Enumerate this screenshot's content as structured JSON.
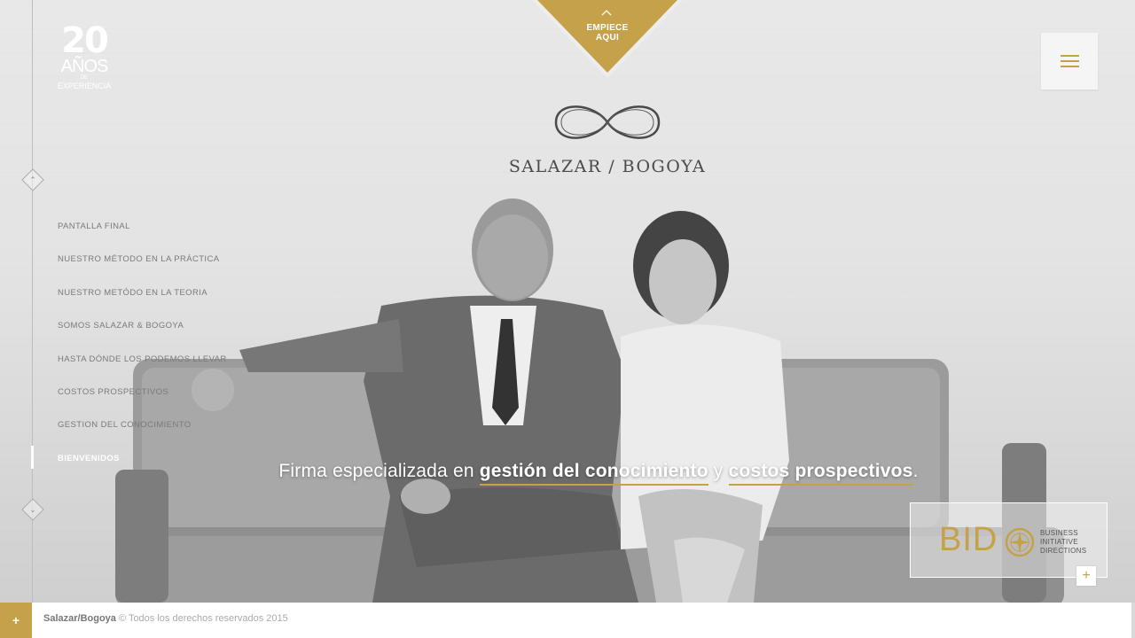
{
  "badge": {
    "number": "20",
    "years": "AÑOS",
    "de": "DE",
    "experience": "EXPERIENCIA"
  },
  "start": {
    "label_line1": "EMPIECE",
    "label_line2": "AQUI"
  },
  "brand": {
    "name": "SALAZAR / BOGOYA"
  },
  "menu": {
    "items": [
      {
        "label": "Pantalla final",
        "active": false
      },
      {
        "label": "Nuestro método en la práctica",
        "active": false
      },
      {
        "label": "Nuestro metódo en la teoria",
        "active": false
      },
      {
        "label": "Somos Salazar & Bogoya",
        "active": false
      },
      {
        "label": "Hasta dónde los podemos llevar",
        "active": false
      },
      {
        "label": "Costos prospectivos",
        "active": false
      },
      {
        "label": "Gestion del conocimiento",
        "active": false
      },
      {
        "label": "Bienvenidos",
        "active": true
      }
    ]
  },
  "tagline": {
    "prefix": "Firma especializada en ",
    "highlight1": "gestión del conocimiento",
    "middle": " y ",
    "highlight2": "costos prospectivos",
    "suffix": "."
  },
  "bido": {
    "word": "BID",
    "line1": "BUSINESS",
    "line2": "INITIATIVE",
    "line3": "DIRECTIONS",
    "plus": "+"
  },
  "footer": {
    "plus": "+",
    "owner": "Salazar/Bogoya",
    "rights": " © Todos los derechos reservados 2015"
  },
  "colors": {
    "accent": "#c5a24a",
    "footer_bg": "#ffffff"
  },
  "icons": [
    "menu-icon",
    "chevron-up-icon",
    "chevron-down-icon",
    "infinity-logo-icon",
    "compass-icon",
    "plus-icon"
  ]
}
